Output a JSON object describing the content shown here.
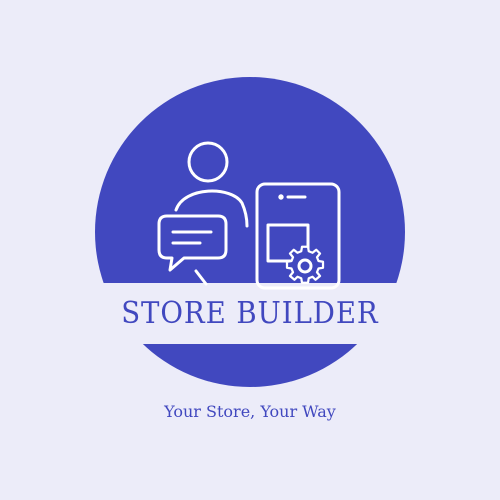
{
  "brand": {
    "name": "STORE BUILDER",
    "tagline": "Your Store, Your Way"
  },
  "colors": {
    "background": "#ECECF9",
    "accent": "#4148BF",
    "icon_stroke": "#FFFFFF"
  },
  "icons": {
    "emblem": "store-builder-logo-icon",
    "person": "person-icon",
    "chat": "chat-bubble-icon",
    "phone": "smartphone-icon",
    "gear": "gear-icon"
  }
}
